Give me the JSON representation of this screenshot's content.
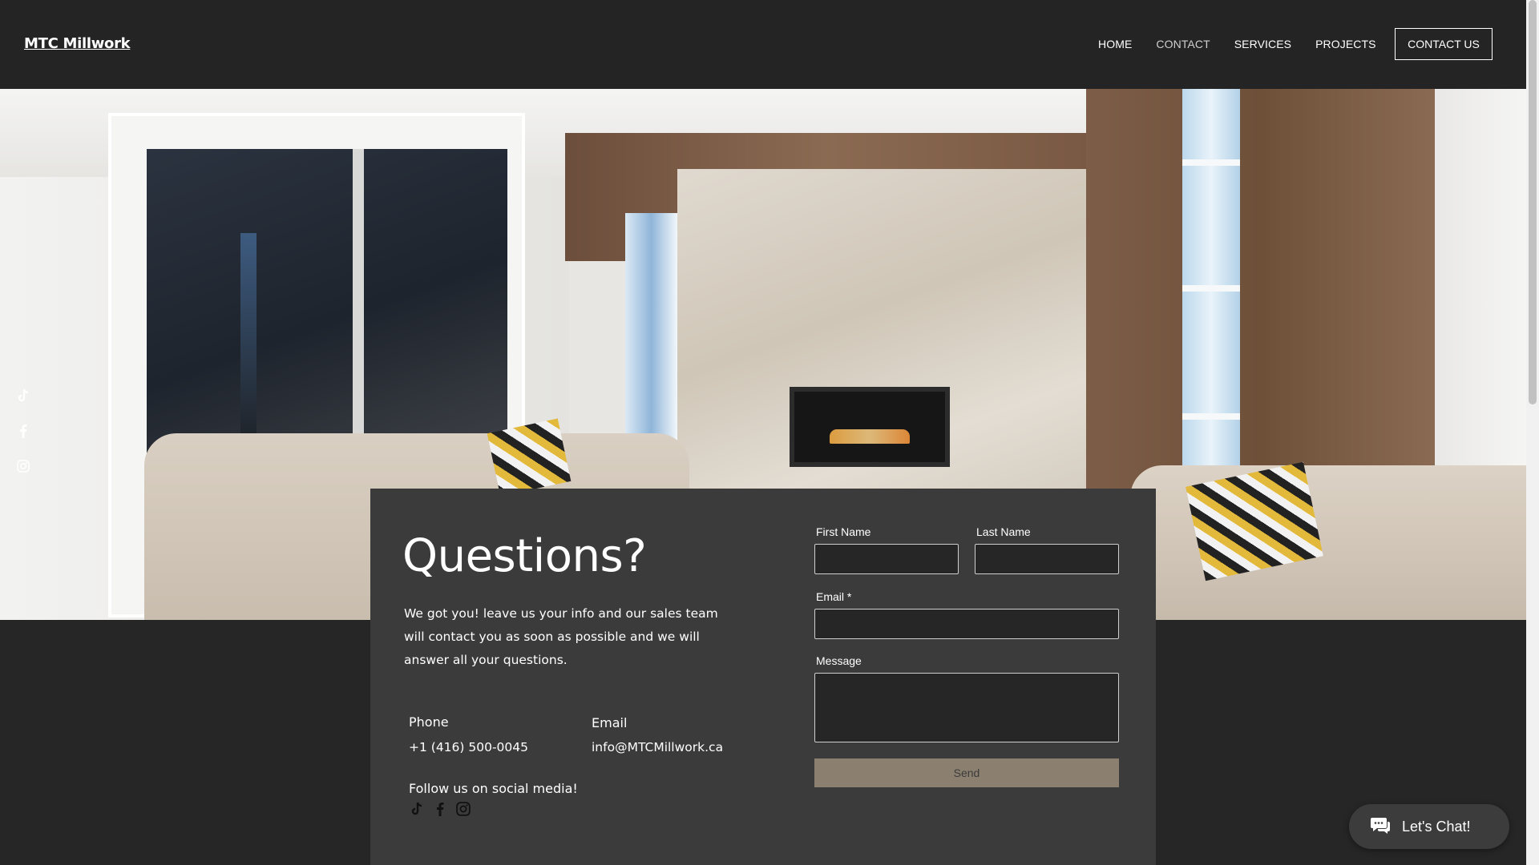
{
  "header": {
    "logo": "MTC Millwork",
    "nav": [
      {
        "label": "HOME"
      },
      {
        "label": "CONTACT",
        "active": true
      },
      {
        "label": "SERVICES"
      },
      {
        "label": "PROJECTS"
      }
    ],
    "cta_label": "CONTACT US"
  },
  "side_social": [
    "tiktok-icon",
    "facebook-icon",
    "instagram-icon"
  ],
  "panel": {
    "title": "Questions?",
    "description": "We got you! leave us your info and our sales team will contact you as soon as possible and we will answer all your questions.",
    "phone_label": "Phone",
    "phone_value": "+1 (416) 500-0045",
    "email_label": "Email",
    "email_value": "info@MTCMillwork.ca",
    "social_label": "Follow us on social media!"
  },
  "form": {
    "first_name_label": "First Name",
    "last_name_label": "Last Name",
    "email_label": "Email *",
    "message_label": "Message",
    "send_label": "Send"
  },
  "chat": {
    "label": "Let's Chat!"
  },
  "colors": {
    "header_bg": "#242424",
    "page_bg": "#262626",
    "panel_bg": "#3b3b3b",
    "send_button": "#8b7f6f"
  }
}
